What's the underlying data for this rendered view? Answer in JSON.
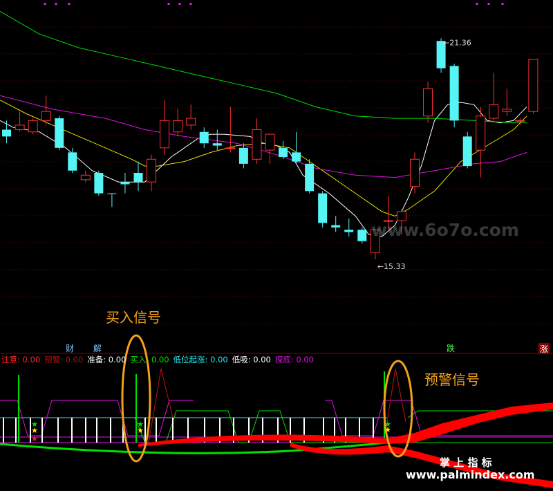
{
  "chart_data": {
    "type": "candlestick",
    "price_labels": {
      "high": "21.36",
      "low": "15.33"
    },
    "y_range": [
      14.6,
      22.2
    ],
    "x_range": [
      0,
      42
    ],
    "candles": [
      {
        "x": 0.5,
        "o": 19.35,
        "h": 19.55,
        "l": 19.05,
        "c": 19.2,
        "up": false
      },
      {
        "x": 1.5,
        "o": 19.35,
        "h": 19.75,
        "l": 19.3,
        "c": 19.45,
        "up": true
      },
      {
        "x": 2.5,
        "o": 19.3,
        "h": 19.6,
        "l": 19.25,
        "c": 19.55,
        "up": true
      },
      {
        "x": 3.5,
        "o": 19.55,
        "h": 20.1,
        "l": 19.45,
        "c": 19.75,
        "up": true
      },
      {
        "x": 4.5,
        "o": 19.6,
        "h": 19.65,
        "l": 18.9,
        "c": 18.95,
        "up": false
      },
      {
        "x": 5.5,
        "o": 18.85,
        "h": 18.95,
        "l": 18.4,
        "c": 18.45,
        "up": false
      },
      {
        "x": 6.5,
        "o": 18.35,
        "h": 18.45,
        "l": 18.2,
        "c": 18.25,
        "up": true
      },
      {
        "x": 7.5,
        "o": 18.4,
        "h": 18.45,
        "l": 17.9,
        "c": 17.95,
        "up": false
      },
      {
        "x": 8.5,
        "o": 17.95,
        "h": 17.95,
        "l": 17.65,
        "c": 17.95,
        "up": false
      },
      {
        "x": 9.5,
        "o": 18.2,
        "h": 18.4,
        "l": 17.95,
        "c": 18.15,
        "up": false
      },
      {
        "x": 10.5,
        "o": 18.2,
        "h": 18.65,
        "l": 18.0,
        "c": 18.4,
        "up": false
      },
      {
        "x": 11.5,
        "o": 18.2,
        "h": 18.8,
        "l": 18.0,
        "c": 18.7,
        "up": true
      },
      {
        "x": 12.5,
        "o": 18.95,
        "h": 20.0,
        "l": 18.8,
        "c": 19.55,
        "up": true
      },
      {
        "x": 13.5,
        "o": 19.3,
        "h": 19.8,
        "l": 19.2,
        "c": 19.55,
        "up": true
      },
      {
        "x": 14.5,
        "o": 19.45,
        "h": 19.9,
        "l": 19.35,
        "c": 19.6,
        "up": true
      },
      {
        "x": 15.5,
        "o": 19.3,
        "h": 19.4,
        "l": 18.95,
        "c": 19.05,
        "up": false
      },
      {
        "x": 16.5,
        "o": 19.05,
        "h": 19.35,
        "l": 18.9,
        "c": 19.0,
        "up": false
      },
      {
        "x": 17.5,
        "o": 18.95,
        "h": 19.85,
        "l": 18.85,
        "c": 18.95,
        "up": true
      },
      {
        "x": 18.5,
        "o": 18.95,
        "h": 19.05,
        "l": 18.5,
        "c": 18.6,
        "up": false
      },
      {
        "x": 19.5,
        "o": 18.7,
        "h": 19.6,
        "l": 18.6,
        "c": 19.35,
        "up": true
      },
      {
        "x": 20.5,
        "o": 18.9,
        "h": 19.25,
        "l": 18.6,
        "c": 19.25,
        "up": true
      },
      {
        "x": 21.5,
        "o": 18.95,
        "h": 19.1,
        "l": 18.7,
        "c": 18.75,
        "up": false
      },
      {
        "x": 22.5,
        "o": 18.85,
        "h": 19.3,
        "l": 18.6,
        "c": 18.65,
        "up": false
      },
      {
        "x": 23.5,
        "o": 18.6,
        "h": 18.7,
        "l": 17.95,
        "c": 18.0,
        "up": false
      },
      {
        "x": 24.5,
        "o": 17.95,
        "h": 18.0,
        "l": 17.2,
        "c": 17.3,
        "up": false
      },
      {
        "x": 25.5,
        "o": 17.25,
        "h": 17.45,
        "l": 17.1,
        "c": 17.2,
        "up": false
      },
      {
        "x": 26.5,
        "o": 17.15,
        "h": 17.4,
        "l": 17.0,
        "c": 17.1,
        "up": false
      },
      {
        "x": 27.5,
        "o": 17.15,
        "h": 17.2,
        "l": 16.85,
        "c": 16.9,
        "up": false
      },
      {
        "x": 28.5,
        "o": 16.65,
        "h": 17.15,
        "l": 16.5,
        "c": 17.15,
        "up": true
      },
      {
        "x": 29.5,
        "o": 17.35,
        "h": 17.9,
        "l": 17.15,
        "c": 17.35,
        "up": true
      },
      {
        "x": 30.5,
        "o": 17.35,
        "h": 17.6,
        "l": 17.05,
        "c": 17.55,
        "up": true
      },
      {
        "x": 31.5,
        "o": 18.1,
        "h": 18.85,
        "l": 17.95,
        "c": 18.7,
        "up": true
      },
      {
        "x": 32.5,
        "o": 19.65,
        "h": 20.4,
        "l": 19.5,
        "c": 20.25,
        "up": true
      },
      {
        "x": 33.5,
        "o": 21.3,
        "h": 21.36,
        "l": 20.6,
        "c": 20.7,
        "up": false
      },
      {
        "x": 34.5,
        "o": 20.75,
        "h": 20.8,
        "l": 19.4,
        "c": 19.55,
        "up": false
      },
      {
        "x": 35.5,
        "o": 19.2,
        "h": 19.3,
        "l": 18.5,
        "c": 18.55,
        "up": false
      },
      {
        "x": 36.5,
        "o": 18.9,
        "h": 19.85,
        "l": 18.3,
        "c": 19.65,
        "up": true
      },
      {
        "x": 37.5,
        "o": 19.6,
        "h": 20.6,
        "l": 19.5,
        "c": 19.9,
        "up": true
      },
      {
        "x": 38.5,
        "o": 19.8,
        "h": 20.25,
        "l": 19.65,
        "c": 19.75,
        "up": true
      },
      {
        "x": 39.5,
        "o": 19.55,
        "h": 19.6,
        "l": 19.45,
        "c": 19.55,
        "up": true
      },
      {
        "x": 40.5,
        "o": 19.75,
        "h": 20.9,
        "l": 19.7,
        "c": 20.9,
        "up": true
      }
    ],
    "ma_lines": [
      {
        "color": "#ffffff",
        "points": [
          [
            0,
            19.55
          ],
          [
            1,
            19.4
          ],
          [
            3,
            19.3
          ],
          [
            5,
            18.95
          ],
          [
            7,
            18.45
          ],
          [
            9,
            18.2
          ],
          [
            11,
            18.2
          ],
          [
            13,
            18.75
          ],
          [
            15,
            19.15
          ],
          [
            16,
            19.25
          ],
          [
            17,
            19.25
          ],
          [
            19,
            19.2
          ],
          [
            20,
            19.05
          ],
          [
            21,
            19.0
          ],
          [
            22,
            18.85
          ],
          [
            23,
            18.35
          ],
          [
            25,
            17.95
          ],
          [
            27,
            17.45
          ],
          [
            28,
            17.05
          ],
          [
            29,
            17.0
          ],
          [
            30,
            17.25
          ],
          [
            31,
            17.85
          ],
          [
            32,
            18.55
          ],
          [
            33,
            19.55
          ],
          [
            34,
            19.9
          ],
          [
            35,
            19.95
          ],
          [
            36,
            19.9
          ],
          [
            37,
            19.55
          ],
          [
            38,
            19.5
          ],
          [
            39,
            19.55
          ],
          [
            40,
            19.85
          ]
        ]
      },
      {
        "color": "#e7e300",
        "points": [
          [
            0,
            20.0
          ],
          [
            2,
            19.7
          ],
          [
            4,
            19.45
          ],
          [
            6,
            19.2
          ],
          [
            8,
            18.95
          ],
          [
            10,
            18.7
          ],
          [
            11,
            18.55
          ],
          [
            12,
            18.55
          ],
          [
            14,
            18.65
          ],
          [
            16,
            18.85
          ],
          [
            18,
            19.0
          ],
          [
            20,
            19.05
          ],
          [
            22,
            18.95
          ],
          [
            23,
            18.75
          ],
          [
            25,
            18.35
          ],
          [
            27,
            17.95
          ],
          [
            29,
            17.55
          ],
          [
            30,
            17.45
          ],
          [
            31,
            17.6
          ],
          [
            33,
            18.0
          ],
          [
            35,
            18.65
          ],
          [
            37,
            19.0
          ],
          [
            39,
            19.35
          ],
          [
            40,
            19.65
          ]
        ]
      },
      {
        "color": "#e012e6",
        "points": [
          [
            0,
            20.1
          ],
          [
            4,
            19.8
          ],
          [
            8,
            19.6
          ],
          [
            11,
            19.35
          ],
          [
            14,
            19.2
          ],
          [
            18,
            19.05
          ],
          [
            21,
            18.8
          ],
          [
            24,
            18.5
          ],
          [
            27,
            18.35
          ],
          [
            30,
            18.3
          ],
          [
            33,
            18.45
          ],
          [
            36,
            18.6
          ],
          [
            38,
            18.65
          ],
          [
            40,
            18.85
          ]
        ]
      },
      {
        "color": "#00e000",
        "points": [
          [
            0,
            21.95
          ],
          [
            3,
            21.45
          ],
          [
            6,
            21.15
          ],
          [
            9,
            20.95
          ],
          [
            12,
            20.75
          ],
          [
            15,
            20.55
          ],
          [
            18,
            20.35
          ],
          [
            21,
            20.15
          ],
          [
            24,
            19.85
          ],
          [
            27,
            19.65
          ],
          [
            30,
            19.6
          ],
          [
            33,
            19.6
          ],
          [
            36,
            19.55
          ],
          [
            39,
            19.5
          ],
          [
            40,
            19.5
          ]
        ]
      }
    ],
    "signal_labels": {
      "cai": "财",
      "jie": "解",
      "die": "跌",
      "zhang": "涨"
    },
    "indicator_legend": [
      {
        "label": "注意: 0.00",
        "color": "#ff2a2a"
      },
      {
        "label": "预警: 0.00",
        "color": "#b01010"
      },
      {
        "label": "准备: 0.00",
        "color": "#ffffff"
      },
      {
        "label": "买入: 0.00",
        "color": "#00e000"
      },
      {
        "label": "低位起涨: 0.00",
        "color": "#2ee8ee"
      },
      {
        "label": "低吸: 0.00",
        "color": "#ffffff"
      },
      {
        "label": "探底: 0.00",
        "color": "#e012e6"
      }
    ],
    "annotations": {
      "buy": "买入信号",
      "warn": "预警信号",
      "brand": "掌 上 指 标",
      "watermark": "www.6o7o.com",
      "url": "www.palmindex.com"
    },
    "colors": {
      "up": "#ff3030",
      "down": "#56f4f4",
      "annotation": "#f2a21a",
      "grid": "#6d0000"
    }
  }
}
